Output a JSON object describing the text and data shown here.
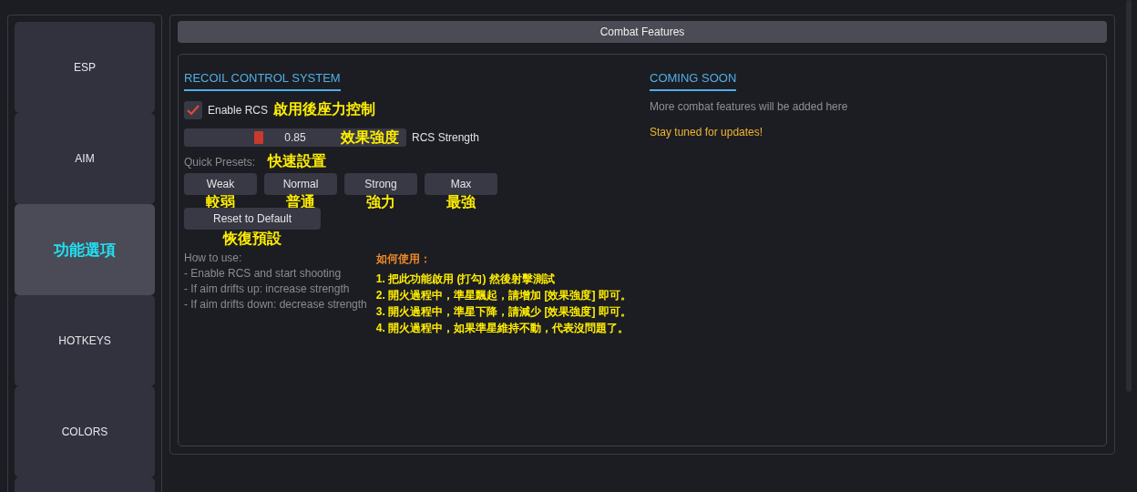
{
  "sidebar": {
    "items": [
      {
        "label": "ESP",
        "selected": false
      },
      {
        "label": "AIM",
        "selected": false
      },
      {
        "label": "功能選項",
        "selected": true
      },
      {
        "label": "HOTKEYS",
        "selected": false
      },
      {
        "label": "COLORS",
        "selected": false
      }
    ]
  },
  "header": {
    "title": "Combat Features"
  },
  "rcs": {
    "title": "RECOIL CONTROL SYSTEM",
    "enable": {
      "label": "Enable RCS",
      "checked": true,
      "annotation": "啟用後座力控制"
    },
    "strength": {
      "reading": "0.85",
      "level": 0.33,
      "annotation": "效果強度",
      "label": "RCS Strength"
    },
    "presets_label": "Quick Presets:",
    "presets_annotation": "快速設置",
    "presets": [
      {
        "label": "Weak",
        "annotation": "較弱"
      },
      {
        "label": "Normal",
        "annotation": "普通"
      },
      {
        "label": "Strong",
        "annotation": "強力"
      },
      {
        "label": "Max",
        "annotation": "最強"
      }
    ],
    "reset": {
      "label": "Reset to Default",
      "annotation": "恢復預設"
    },
    "help": [
      "How to use:",
      "- Enable RCS and start shooting",
      "- If aim drifts up: increase strength",
      "- If aim drifts down: decrease strength"
    ],
    "guide_title": "如何使用：",
    "guide": [
      "1. 把此功能啟用 (打勾) 然後射擊測試",
      "2. 開火過程中，準星飄起，請增加 [效果強度] 即可。",
      "3. 開火過程中，準星下降，請減少 [效果強度] 即可。",
      "4. 開火過程中，如果準星維持不動，代表沒問題了。"
    ]
  },
  "coming": {
    "title": "COMING SOON",
    "text": "More combat features will be added here",
    "note": "Stay tuned for updates!"
  }
}
